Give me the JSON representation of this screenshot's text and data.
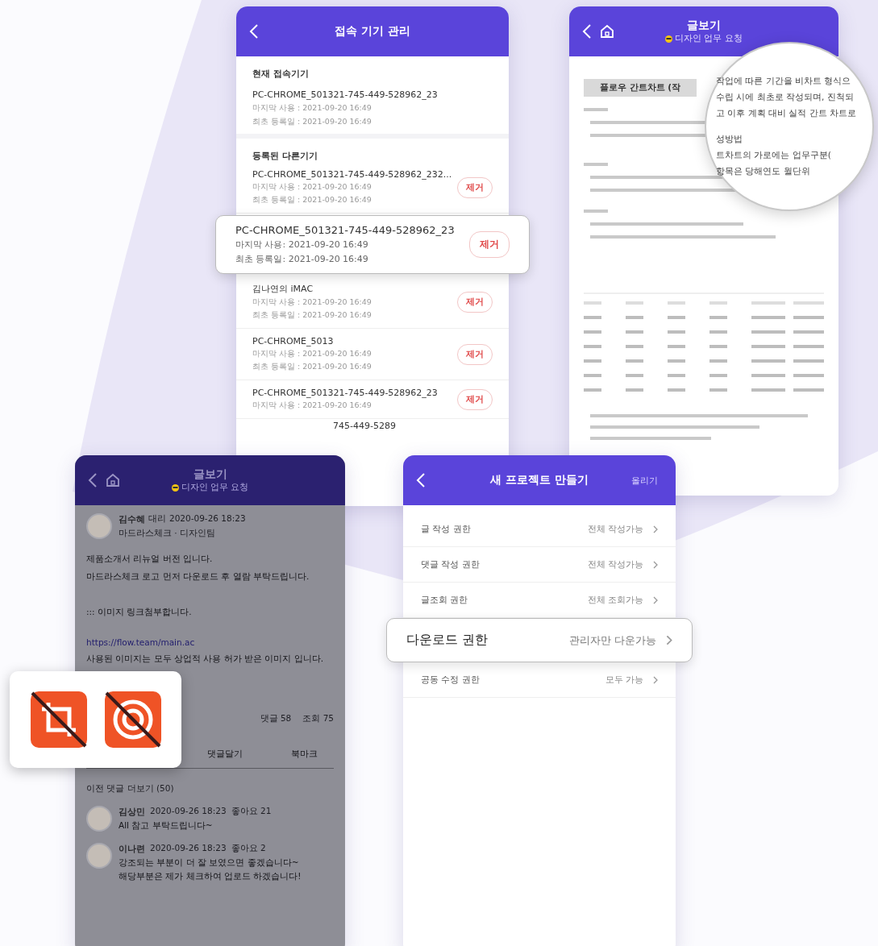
{
  "devices_screen": {
    "title": "접속 기기 관리",
    "current_heading": "현재 접속기기",
    "current": {
      "name": "PC-CHROME_501321-745-449-528962_23",
      "last_used": "마지막 사용 : 2021-09-20 16:49",
      "registered": "최초 등록일 : 2021-09-20 16:49"
    },
    "others_heading": "등록된 다른기기",
    "others": [
      {
        "name": "PC-CHROME_501321-745-449-528962_232...",
        "last_used": "마지막 사용 : 2021-09-20 16:49",
        "registered": "최초 등록일 : 2021-09-20 16:49",
        "remove": "제거",
        "highlighted": false
      },
      {
        "name": "PC-CHROME_501321-745-449-528962_23",
        "last_used": "마지막 사용: 2021-09-20 16:49",
        "registered": "최초 등록일: 2021-09-20 16:49",
        "remove": "제거",
        "highlighted": true
      },
      {
        "name": "김나연의 iMAC",
        "last_used": "마지막 사용 : 2021-09-20 16:49",
        "registered": "최초 등록일 : 2021-09-20 16:49",
        "remove": "제거",
        "highlighted": false
      },
      {
        "name": "PC-CHROME_5013",
        "last_used": "마지막 사용 : 2021-09-20 16:49",
        "registered": "최초 등록일 : 2021-09-20 16:49",
        "remove": "제거",
        "highlighted": false
      },
      {
        "name": "PC-CHROME_501321-745-449-528962_23",
        "last_used": "마지막 사용 : 2021-09-20 16:49",
        "remove": "제거",
        "highlighted": false
      }
    ],
    "partial_row": "745-449-5289"
  },
  "document_screen": {
    "title": "글보기",
    "subtitle": "디자인 업무 요청",
    "doc_heading": "플로우 간트차트 (작",
    "magnifier_lines": [
      "작업에 따른 기간을 비차트 형식으",
      "수립 시에 최초로 작성되며, 진척되",
      "고 이후 계획 대비 실적 간트 차트로",
      "성방법",
      "트차트의 가로에는 업무구분(",
      "항목은 당해연도 월단위"
    ]
  },
  "post_screen": {
    "title": "글보기",
    "subtitle": "디자인 업무 요청",
    "author": "김수혜",
    "rank": "대리",
    "time": "2020-09-26 18:23",
    "team": "마드라스체크 · 디자인팀",
    "body_lines": [
      "제품소개서 리뉴얼 버전 입니다.",
      "마드라스체크 로고 먼저 다운로드 후 열람 부탁드립니다.",
      "::: 이미지 링크첨부합니다."
    ],
    "link": "https://flow.team/main.ac",
    "body_after": "사용된 이미지는 모두 상업적 사용 허가 받은 이미지 입니다.",
    "stats": [
      "댓글 58",
      "조회 75"
    ],
    "actions": [
      "댓글달기",
      "북마크"
    ],
    "more_comments": "이전 댓글 더보기 (50)",
    "comments": [
      {
        "name": "김상민",
        "time": "2020-09-26 18:23",
        "reaction": "좋아요 21",
        "lines": [
          "All 참고 부탁드립니다~"
        ]
      },
      {
        "name": "이나련",
        "time": "2020-09-26 18:23",
        "reaction": "좋아요 2",
        "lines": [
          "강조되는 부분이 더 잘 보였으면 좋겠습니다~",
          "해당부분은 제가 체크하여 업로드 하겠습니다!"
        ]
      }
    ]
  },
  "settings_screen": {
    "title": "새 프로젝트 만들기",
    "action": "올리기",
    "rows": [
      {
        "label": "글 작성 권한",
        "value": "전체 작성가능",
        "highlighted": false
      },
      {
        "label": "댓글 작성 권한",
        "value": "전체 작성가능",
        "highlighted": false
      },
      {
        "label": "글조회 권한",
        "value": "전체 조회가능",
        "highlighted": false
      },
      {
        "label": "다운로드 권한",
        "value": "관리자만 다운가능",
        "highlighted": true
      },
      {
        "label": "공동 수정 권한",
        "value": "모두 가능",
        "highlighted": false
      }
    ]
  }
}
